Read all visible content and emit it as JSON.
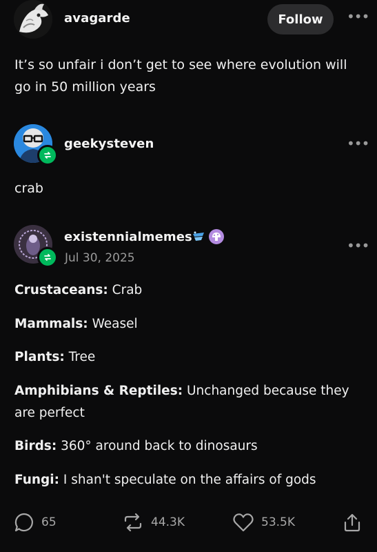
{
  "post": {
    "author": "avagarde",
    "follow_label": "Follow",
    "more_glyph": "•••",
    "text": "It’s so unfair i don’t get to see where evolution will go in 50 million years"
  },
  "reblog1": {
    "author": "geekysteven",
    "more_glyph": "•••",
    "text": "crab"
  },
  "reblog2": {
    "author": "existennialmemes",
    "date": "Jul 30, 2025",
    "more_glyph": "•••",
    "items": [
      {
        "label": "Crustaceans:",
        "text": " Crab"
      },
      {
        "label": "Mammals:",
        "text": " Weasel"
      },
      {
        "label": "Plants:",
        "text": " Tree"
      },
      {
        "label": "Amphibians & Reptiles:",
        "text": " Unchanged because they are perfect"
      },
      {
        "label": "Birds:",
        "text": " 360° around back to dinosaurs"
      },
      {
        "label": "Fungi:",
        "text": " I shan't speculate on the affairs of gods"
      }
    ]
  },
  "footer": {
    "comments": "65",
    "reblogs": "44.3K",
    "likes": "53.5K",
    "icons": [
      "comment-icon",
      "reblog-icon",
      "heart-icon",
      "share-icon"
    ]
  },
  "colors": {
    "background": "#0b0b0c",
    "reblog_green": "#00b85c",
    "muted": "#a8a8a8",
    "button_bg": "#2c2c2e"
  }
}
